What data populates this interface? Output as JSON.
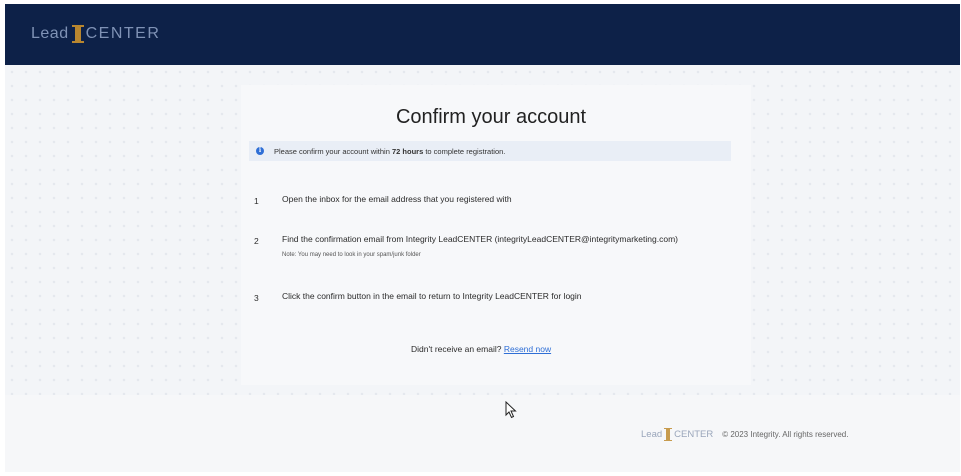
{
  "header": {
    "logo_part1": "Lead",
    "logo_part2": "CENTER"
  },
  "main": {
    "title": "Confirm your account",
    "notice": {
      "prefix": "Please confirm your account within ",
      "emphasis": "72 hours",
      "suffix": " to complete registration."
    },
    "steps": [
      {
        "number": "1",
        "text": "Open the inbox for the email address that you registered with"
      },
      {
        "number": "2",
        "text": "Find the confirmation email from Integrity LeadCENTER (integrityLeadCENTER@integritymarketing.com)",
        "note": "Note: You may need to look in your spam/junk folder"
      },
      {
        "number": "3",
        "text": "Click the confirm button in the email to return to Integrity LeadCENTER for login"
      }
    ],
    "resend_prompt": "Didn't receive an email?",
    "resend_link": "Resend now"
  },
  "footer": {
    "logo_part1": "Lead",
    "logo_part2": "CENTER",
    "copyright": "© 2023 Integrity. All rights reserved."
  },
  "colors": {
    "header_bg": "#0d2148",
    "accent_gold": "#b8862f",
    "link": "#2f6fd6",
    "info_icon": "#2f6fd6"
  }
}
